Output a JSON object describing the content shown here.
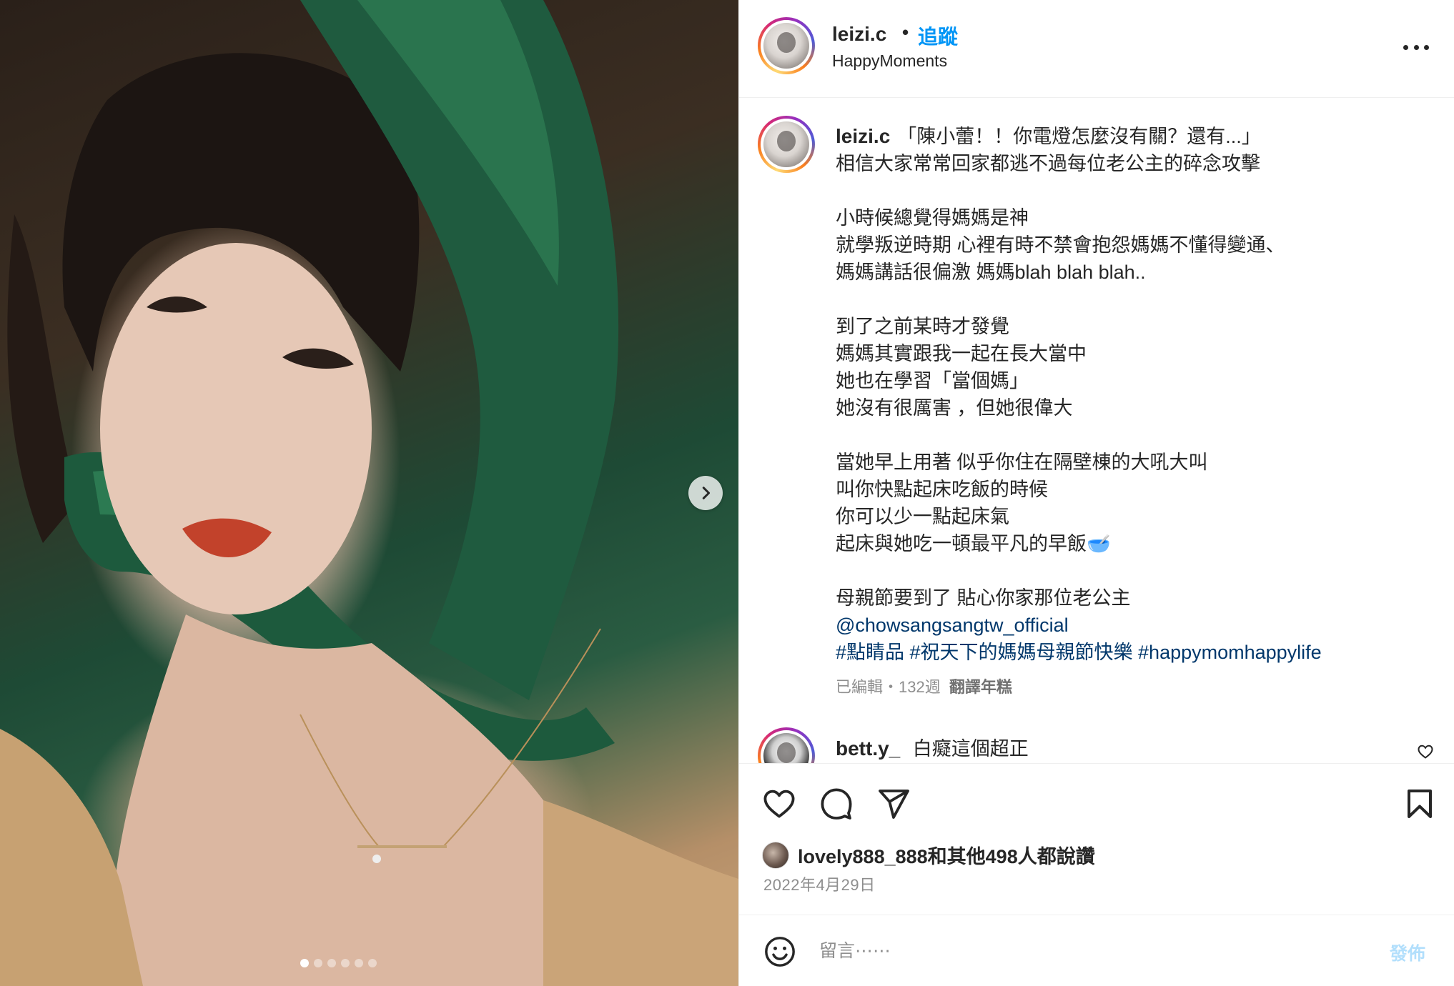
{
  "post": {
    "carousel": {
      "slide_count": 6,
      "active_index": 0,
      "next_icon": "chevron-right-icon"
    },
    "author": {
      "username": "leizi.c",
      "follow_label": "追蹤",
      "separator": "•",
      "subtitle": "HappyMoments"
    },
    "caption": {
      "username": "leizi.c",
      "body": "「陳小蕾！！你電燈怎麼沒有關？還有...」\n相信大家常常回家都逃不過每位老公主的碎念攻擊\n\n小時候總覺得媽媽是神\n就學叛逆時期 心裡有時不禁會抱怨媽媽不懂得變通、\n媽媽講話很偏激 媽媽blah blah blah..\n\n到了之前某時才發覺\n媽媽其實跟我一起在長大當中\n她也在學習「當個媽」\n她沒有很厲害 ，但她很偉大\n\n當她早上用著 似乎你住在隔壁棟的大吼大叫\n叫你快點起床吃飯的時候\n你可以少一點起床氣\n起床與她吃一頓最平凡的早飯🥣\n\n母親節要到了 貼心你家那位老公主\n",
      "mention": "@chowsangsangtw_official",
      "hashtags": "#點睛品 #祝天下的媽媽母親節快樂 #happymomhappylife",
      "meta": "已編輯・132週",
      "translate_label": "翻譯年糕"
    },
    "comments": [
      {
        "username": "bett.y_",
        "text": "白癡這個超正"
      }
    ],
    "actions": {
      "like_icon": "heart-icon",
      "comment_icon": "comment-icon",
      "share_icon": "send-icon",
      "save_icon": "bookmark-icon"
    },
    "likes_text": "lovely888_888和其他498人都說讚",
    "date": "2022年4月29日",
    "comment_box": {
      "placeholder": "留言⋯⋯",
      "post_label": "發佈",
      "emoji_icon": "smiley-icon"
    }
  }
}
